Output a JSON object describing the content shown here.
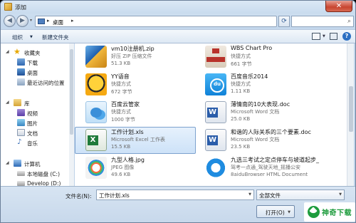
{
  "window": {
    "title": "添加",
    "close_glyph": "✕"
  },
  "nav": {
    "back_glyph": "◀",
    "forward_glyph": "▶",
    "dropdown_glyph": "▾",
    "address": {
      "crumb": "桌面",
      "sep1": "▸",
      "sep2": "▸"
    },
    "refresh_glyph": "⟳",
    "search_placeholder": "",
    "search_glyph": "⌕"
  },
  "toolbar": {
    "organize": "组织",
    "organize_arrow": "▼",
    "new_folder": "新建文件夹",
    "view_arrow": "▼",
    "help_glyph": "?"
  },
  "sidebar": {
    "favorites": {
      "label": "收藏夹",
      "icon": "star-icon",
      "glyph": "★",
      "expander": "◢"
    },
    "favorite_items": [
      {
        "label": "下载",
        "icon": "download-folder-icon"
      },
      {
        "label": "桌面",
        "icon": "desktop-icon"
      },
      {
        "label": "最近访问的位置",
        "icon": "recent-places-icon"
      }
    ],
    "libraries": {
      "label": "库",
      "icon": "library-icon",
      "expander": "◢"
    },
    "library_items": [
      {
        "label": "视频",
        "icon": "video-library-icon"
      },
      {
        "label": "图片",
        "icon": "pictures-library-icon"
      },
      {
        "label": "文档",
        "icon": "documents-library-icon"
      },
      {
        "label": "音乐",
        "icon": "music-library-icon",
        "glyph": "♪"
      }
    ],
    "computer": {
      "label": "计算机",
      "icon": "computer-icon",
      "expander": "◢"
    },
    "computer_items": [
      {
        "label": "本地磁盘 (C:)",
        "icon": "drive-icon"
      },
      {
        "label": "Develop (D:)",
        "icon": "drive-icon"
      }
    ]
  },
  "files": [
    {
      "name": "vm10注册机.zip",
      "type": "好压 ZIP 压缩文件",
      "size": "51.3 KB",
      "icon": "zip-archive-icon",
      "selected": false
    },
    {
      "name": "WBS Chart Pro",
      "type": "快捷方式",
      "size": "661 字节",
      "icon": "wbs-chart-icon",
      "selected": false
    },
    {
      "name": "YY语音",
      "type": "快捷方式",
      "size": "672 字节",
      "icon": "yy-voice-icon",
      "selected": false
    },
    {
      "name": "百度音乐2014",
      "type": "快捷方式",
      "size": "1.11 KB",
      "icon": "baidu-music-icon",
      "selected": false
    },
    {
      "name": "百度云管家",
      "type": "快捷方式",
      "size": "1000 字节",
      "icon": "baidu-cloud-icon",
      "selected": false
    },
    {
      "name": "薄情南的10大表现.doc",
      "type": "Microsoft Word 文档",
      "size": "25.0 KB",
      "icon": "word-document-icon",
      "selected": false
    },
    {
      "name": "工作计划.xls",
      "type": "Microsoft Excel 工作表",
      "size": "15.5 KB",
      "icon": "excel-workbook-icon",
      "selected": true
    },
    {
      "name": "和谐的人际关系的三个要素.doc",
      "type": "Microsoft Word 文档",
      "size": "23.5 KB",
      "icon": "word-document-icon",
      "selected": false
    },
    {
      "name": "九型人格.jpg",
      "type": "JPEG 图像",
      "size": "49.6 KB",
      "icon": "jpeg-image-icon",
      "selected": false
    },
    {
      "name": "九选三考试之定点停车与坡道起步_",
      "type": "驾考一点通_驾驶天地_摇播公安",
      "size": "8aiduBrowser HTML Document",
      "icon": "browser-document-icon",
      "selected": false
    }
  ],
  "footer": {
    "filename_label": "文件名(N):",
    "filename_value": "工作计划.xls",
    "filename_arrow": "▼",
    "filetype_value": "全部文件",
    "filetype_arrow": "▼",
    "open_label": "打开(O)",
    "open_arrow": "▼"
  },
  "watermark": {
    "text": "神奇下载"
  }
}
